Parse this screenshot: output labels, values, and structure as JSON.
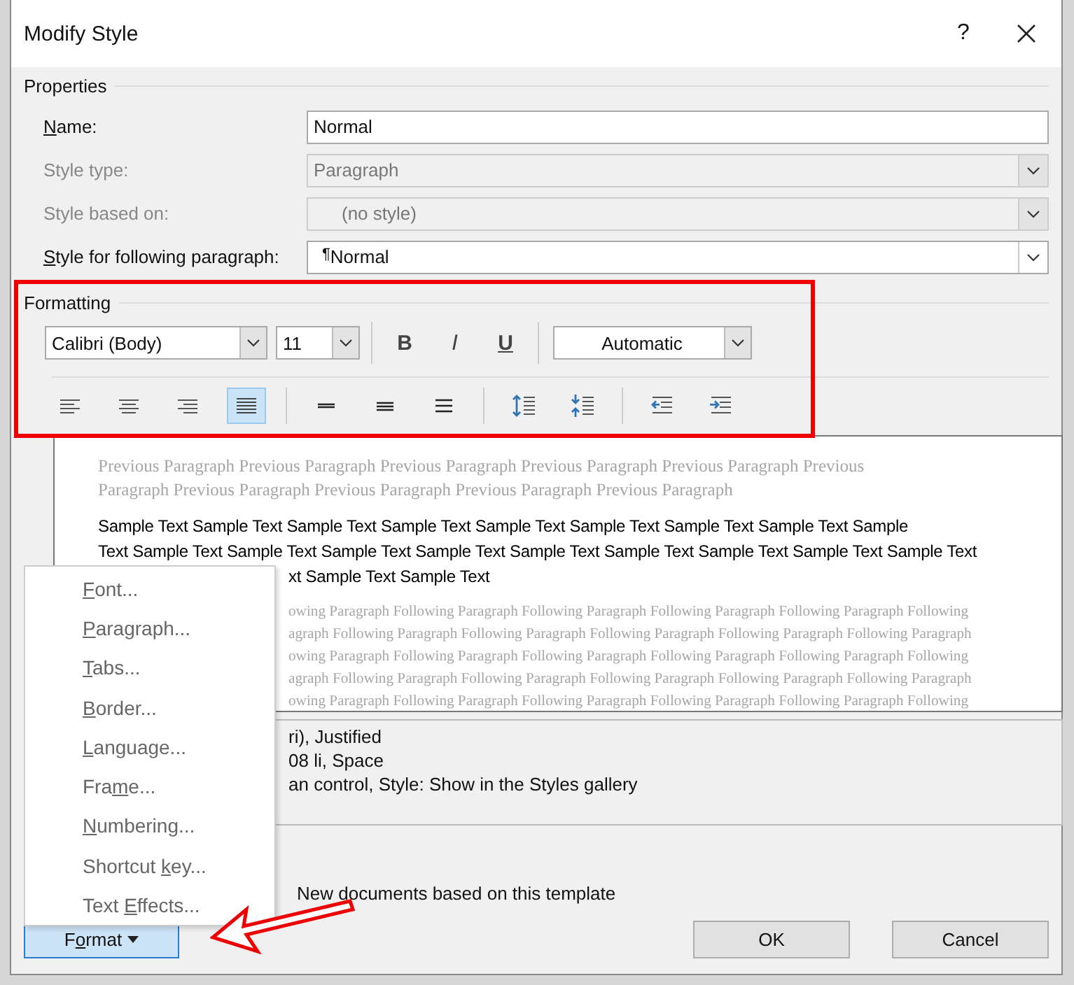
{
  "window": {
    "title": "Modify Style",
    "help": "?"
  },
  "properties": {
    "title": "Properties",
    "rows": [
      {
        "kind": "text",
        "disabled": false,
        "label": [
          {
            "text": "N",
            "access_key": true
          },
          {
            "text": "ame:",
            "access_key": false
          }
        ],
        "value": "Normal"
      },
      {
        "kind": "dropdown",
        "disabled": true,
        "label": [
          {
            "text": "Style type:",
            "access_key": false
          }
        ],
        "value": "Paragraph"
      },
      {
        "kind": "dropdown",
        "disabled": true,
        "label": [
          {
            "text": "Style based on:",
            "access_key": false
          }
        ],
        "value": "(no style)"
      },
      {
        "kind": "dropdown",
        "disabled": false,
        "label": [
          {
            "text": "S",
            "access_key": true
          },
          {
            "text": "tyle for following paragraph:",
            "access_key": false
          }
        ],
        "pilcrow": "¶",
        "value": "Normal"
      }
    ]
  },
  "formatting": {
    "title": "Formatting",
    "font": "Calibri (Body)",
    "size": "11",
    "bold": "B",
    "italic": "I",
    "underline": "U",
    "font_color": "Automatic",
    "buttons": [
      {
        "kind": "align-left",
        "selected": false
      },
      {
        "kind": "align-center",
        "selected": false
      },
      {
        "kind": "align-right",
        "selected": false
      },
      {
        "kind": "justify",
        "selected": true
      },
      {
        "kind": "single-spacing",
        "selected": false
      },
      {
        "kind": "one-half-spacing",
        "selected": false
      },
      {
        "kind": "double-spacing",
        "selected": false
      },
      {
        "kind": "increase-spacing",
        "selected": false
      },
      {
        "kind": "decrease-spacing",
        "selected": false
      },
      {
        "kind": "decrease-indent",
        "selected": false
      },
      {
        "kind": "increase-indent",
        "selected": false
      }
    ]
  },
  "preview": {
    "previous": [
      "Previous Paragraph Previous Paragraph Previous Paragraph Previous Paragraph Previous Paragraph Previous",
      "Paragraph Previous Paragraph Previous Paragraph Previous Paragraph Previous Paragraph"
    ],
    "sample": [
      "Sample Text Sample Text Sample Text Sample Text Sample Text Sample Text Sample Text Sample Text Sample",
      "Text Sample Text Sample Text Sample Text Sample Text Sample Text Sample Text Sample Text Sample Text Sample Text"
    ],
    "sample_partial": [
      "xt Sample Text Sample Text"
    ],
    "following": [
      "owing Paragraph Following Paragraph Following Paragraph Following Paragraph Following Paragraph Following",
      "agraph Following Paragraph Following Paragraph Following Paragraph Following Paragraph Following Paragraph",
      "owing Paragraph Following Paragraph Following Paragraph Following Paragraph Following Paragraph Following",
      "agraph Following Paragraph Following Paragraph Following Paragraph Following Paragraph Following Paragraph",
      "owing Paragraph Following Paragraph Following Paragraph Following Paragraph Following Paragraph Following"
    ]
  },
  "description": [
    "ri), Justified",
    "08 li, Space",
    "an control, Style: Show in the Styles gallery"
  ],
  "template_option": "New documents based on this template",
  "format_menu": {
    "items": [
      [
        {
          "text": "F",
          "access_key": true
        },
        {
          "text": "ont...",
          "access_key": false
        }
      ],
      [
        {
          "text": "P",
          "access_key": true
        },
        {
          "text": "aragraph...",
          "access_key": false
        }
      ],
      [
        {
          "text": "T",
          "access_key": true
        },
        {
          "text": "abs...",
          "access_key": false
        }
      ],
      [
        {
          "text": "B",
          "access_key": true
        },
        {
          "text": "order...",
          "access_key": false
        }
      ],
      [
        {
          "text": "L",
          "access_key": true
        },
        {
          "text": "anguage...",
          "access_key": false
        }
      ],
      [
        {
          "text": "Fra",
          "access_key": false
        },
        {
          "text": "m",
          "access_key": true
        },
        {
          "text": "e...",
          "access_key": false
        }
      ],
      [
        {
          "text": "N",
          "access_key": true
        },
        {
          "text": "umbering...",
          "access_key": false
        }
      ],
      [
        {
          "text": "Shortcut ",
          "access_key": false
        },
        {
          "text": "k",
          "access_key": true
        },
        {
          "text": "ey...",
          "access_key": false
        }
      ],
      [
        {
          "text": "Text ",
          "access_key": false
        },
        {
          "text": "E",
          "access_key": true
        },
        {
          "text": "ffects...",
          "access_key": false
        }
      ]
    ]
  },
  "format_button": [
    {
      "text": "F",
      "access_key": false
    },
    {
      "text": "o",
      "access_key": true
    },
    {
      "text": "rmat",
      "access_key": false
    }
  ],
  "buttons": [
    "OK",
    "Cancel"
  ]
}
